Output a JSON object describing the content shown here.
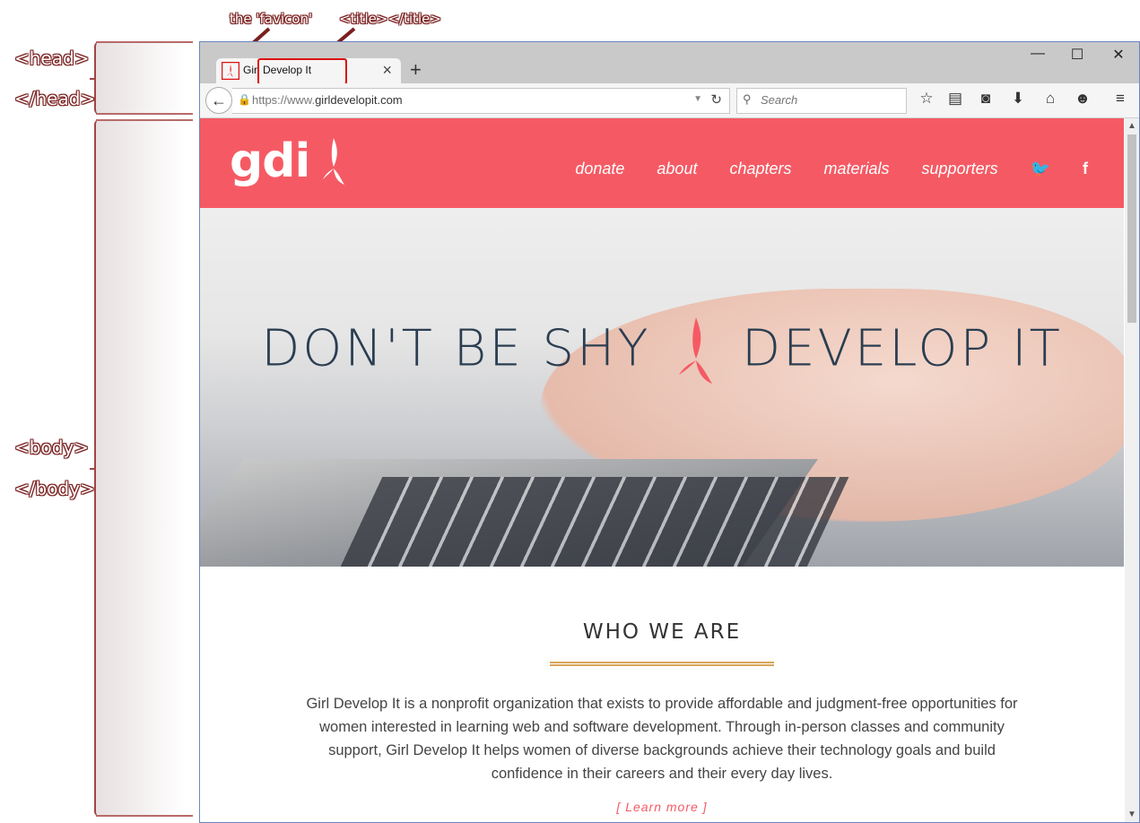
{
  "annotations": {
    "favicon_label": "the 'favicon'",
    "title_label": "<title></title>",
    "head_open": "<head>",
    "head_close": "</head>",
    "body_open": "<body>",
    "body_close": "</body>"
  },
  "browser": {
    "tab_title": "Girl Develop It",
    "url_prefix": "https://www.",
    "url_domain": "girldevelopit.com",
    "search_placeholder": "Search"
  },
  "site": {
    "logo": "gdi",
    "nav": [
      "donate",
      "about",
      "chapters",
      "materials",
      "supporters"
    ],
    "hero_left": "DON'T BE SHY",
    "hero_right": "DEVELOP IT",
    "section_title": "WHO WE ARE",
    "description": "Girl Develop It is a nonprofit organization that exists to provide affordable and judgment-free opportunities for women interested in learning web and software development. Through in-person classes and community support, Girl Develop It helps women of diverse backgrounds achieve their technology goals and build confidence in their careers and their every day lives.",
    "learn_more": "[ Learn more ]"
  },
  "colors": {
    "brand": "#f55a64",
    "heading": "#2b3e51",
    "rule": "#d8a55a"
  }
}
